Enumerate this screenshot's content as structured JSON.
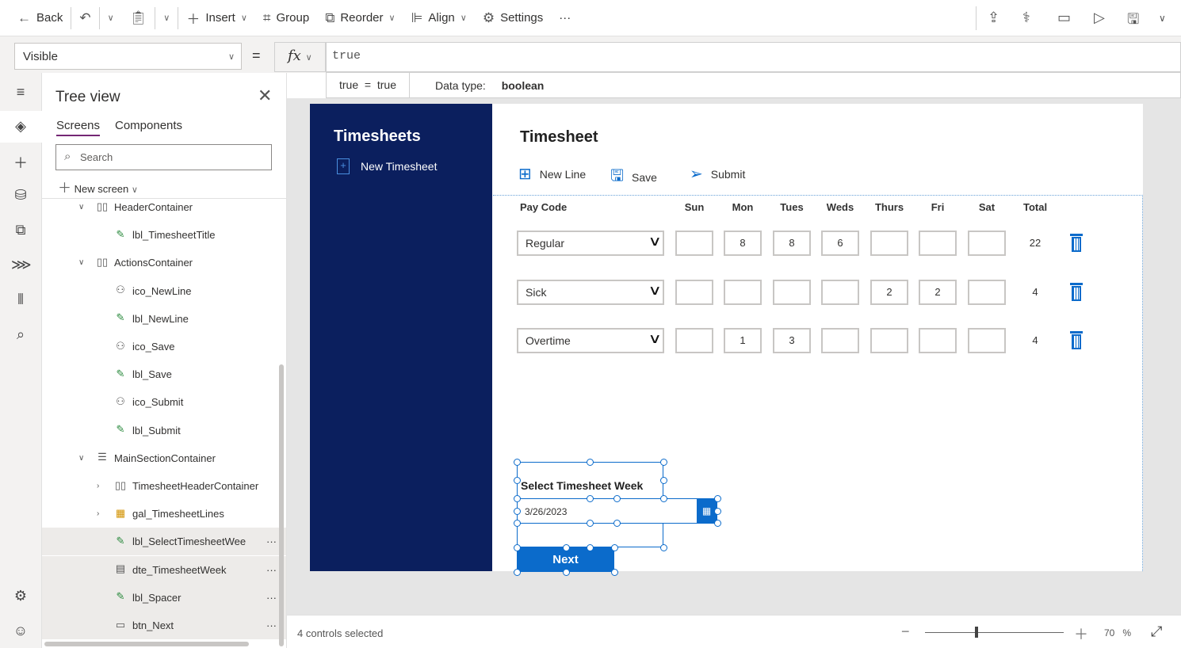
{
  "toolbar": {
    "back": "Back",
    "insert": "Insert",
    "group": "Group",
    "reorder": "Reorder",
    "align": "Align",
    "settings": "Settings",
    "more": "···"
  },
  "formula_bar": {
    "property": "Visible",
    "equals": "=",
    "fx": "fx",
    "formula": "true",
    "result_expr": "true  =  true",
    "data_type_label": "Data type: ",
    "data_type": "boolean"
  },
  "tree": {
    "title": "Tree view",
    "tabs": [
      "Screens",
      "Components"
    ],
    "search_placeholder": "Search",
    "new_screen": "New screen",
    "items": [
      {
        "label": "HeaderContainer",
        "icon": "container-icon",
        "level": 1,
        "chevron": "down"
      },
      {
        "label": "lbl_TimesheetTitle",
        "icon": "label-icon",
        "level": 2
      },
      {
        "label": "ActionsContainer",
        "icon": "container-icon",
        "level": 1,
        "chevron": "down"
      },
      {
        "label": "ico_NewLine",
        "icon": "shapes-icon",
        "level": 2
      },
      {
        "label": "lbl_NewLine",
        "icon": "label-icon",
        "level": 2
      },
      {
        "label": "ico_Save",
        "icon": "shapes-icon",
        "level": 2
      },
      {
        "label": "lbl_Save",
        "icon": "label-icon",
        "level": 2
      },
      {
        "label": "ico_Submit",
        "icon": "shapes-icon",
        "level": 2
      },
      {
        "label": "lbl_Submit",
        "icon": "label-icon",
        "level": 2
      },
      {
        "label": "MainSectionContainer",
        "icon": "vertical-container-icon",
        "level": 1,
        "chevron": "down"
      },
      {
        "label": "TimesheetHeaderContainer",
        "icon": "container-icon",
        "level": 2,
        "chevron": "right"
      },
      {
        "label": "gal_TimesheetLines",
        "icon": "gallery-icon",
        "level": 2,
        "chevron": "right"
      },
      {
        "label": "lbl_SelectTimesheetWee",
        "icon": "label-icon",
        "level": 2,
        "selected": true
      },
      {
        "label": "dte_TimesheetWeek",
        "icon": "date-picker-icon",
        "level": 2,
        "selected": true
      },
      {
        "label": "lbl_Spacer",
        "icon": "label-icon",
        "level": 2,
        "selected": true
      },
      {
        "label": "btn_Next",
        "icon": "button-icon",
        "level": 2,
        "selected": true
      }
    ]
  },
  "app": {
    "nav_title": "Timesheets",
    "nav_new": "New Timesheet",
    "title": "Timesheet",
    "actions": [
      "New Line",
      "Save",
      "Submit"
    ],
    "headers": [
      "Pay Code",
      "Sun",
      "Mon",
      "Tues",
      "Weds",
      "Thurs",
      "Fri",
      "Sat",
      "Total"
    ],
    "rows": [
      {
        "pay_code": "Regular",
        "days": [
          "",
          "8",
          "8",
          "6",
          "",
          "",
          ""
        ],
        "total": "22"
      },
      {
        "pay_code": "Sick",
        "days": [
          "",
          "",
          "",
          "",
          "2",
          "2",
          ""
        ],
        "total": "4"
      },
      {
        "pay_code": "Overtime",
        "days": [
          "",
          "1",
          "3",
          "",
          "",
          "",
          ""
        ],
        "total": "4"
      }
    ],
    "week_label": "Select Timesheet Week",
    "week_date": "3/26/2023",
    "next": "Next"
  },
  "status": {
    "text": "4 controls selected",
    "zoom": "70",
    "zoom_unit": "%"
  },
  "colors": {
    "nav": "#0b1f5e",
    "accent": "#0b6bcb",
    "selection": "#742774"
  }
}
